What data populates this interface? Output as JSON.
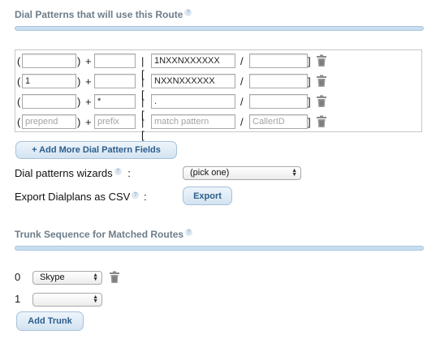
{
  "dial_patterns": {
    "title": "Dial Patterns that will use this Route",
    "rows": [
      {
        "prepend": "",
        "prefix": "",
        "match_pattern": "1NXXNXXXXXX",
        "caller_id": ""
      },
      {
        "prepend": "1",
        "prefix": "",
        "match_pattern": "NXXNXXXXXX",
        "caller_id": ""
      },
      {
        "prepend": "",
        "prefix": "*",
        "match_pattern": ".",
        "caller_id": ""
      },
      {
        "prepend": "",
        "prefix": "",
        "match_pattern": "",
        "caller_id": ""
      }
    ],
    "placeholders": {
      "prepend": "prepend",
      "prefix": "prefix",
      "match_pattern": "match pattern",
      "caller_id": "CallerID"
    },
    "symbols": {
      "open_paren": "(",
      "close_paren": ")",
      "plus": "+",
      "pipe_bracket": "| [",
      "slash": "/",
      "close_bracket": "]"
    },
    "add_more_label": "+ Add More Dial Pattern Fields",
    "wizards_label": "Dial patterns wizards",
    "wizards_colon": ":",
    "wizards_selected": "(pick one)",
    "export_label": "Export Dialplans as CSV",
    "export_colon": ":",
    "export_button": "Export"
  },
  "trunk_sequence": {
    "title": "Trunk Sequence for Matched Routes",
    "items": [
      {
        "index": "0",
        "selected": "Skype"
      },
      {
        "index": "1",
        "selected": ""
      }
    ],
    "add_trunk_label": "Add Trunk"
  },
  "icons": {
    "help": "help-icon",
    "trash": "trash-icon",
    "select_arrows": "updown-arrows-icon"
  },
  "colors": {
    "section_title": "#6d7d8a",
    "button_text": "#2c5d8c",
    "divider": "#c8def0"
  }
}
